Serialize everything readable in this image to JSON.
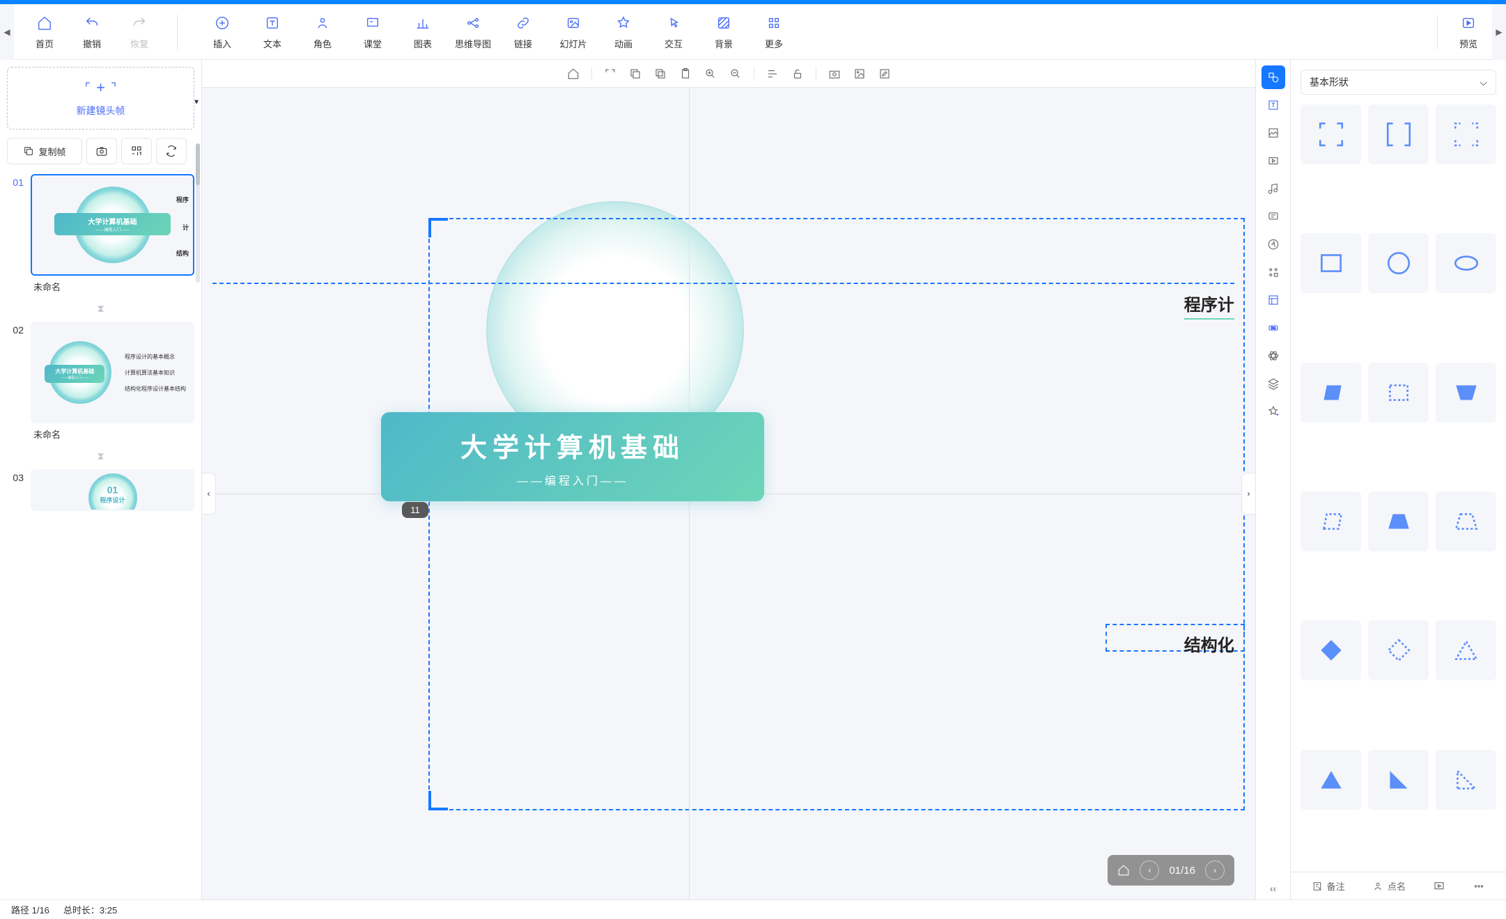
{
  "toolbar": {
    "left": [
      {
        "name": "home",
        "label": "首页",
        "icon": "home"
      },
      {
        "name": "undo",
        "label": "撤销",
        "icon": "undo"
      },
      {
        "name": "redo",
        "label": "恢复",
        "icon": "redo",
        "disabled": true
      }
    ],
    "main": [
      {
        "name": "insert",
        "label": "插入",
        "icon": "plus-circle"
      },
      {
        "name": "text",
        "label": "文本",
        "icon": "text"
      },
      {
        "name": "character",
        "label": "角色",
        "icon": "person"
      },
      {
        "name": "classroom",
        "label": "课堂",
        "icon": "class"
      },
      {
        "name": "chart",
        "label": "图表",
        "icon": "bar-chart"
      },
      {
        "name": "mindmap",
        "label": "思维导图",
        "icon": "mindmap"
      },
      {
        "name": "link",
        "label": "链接",
        "icon": "link"
      },
      {
        "name": "slideshow",
        "label": "幻灯片",
        "icon": "image"
      },
      {
        "name": "animation",
        "label": "动画",
        "icon": "star"
      },
      {
        "name": "interaction",
        "label": "交互",
        "icon": "pointer"
      },
      {
        "name": "background",
        "label": "背景",
        "icon": "stripes"
      },
      {
        "name": "more",
        "label": "更多",
        "icon": "grid"
      }
    ],
    "preview": {
      "label": "预览",
      "icon": "play"
    }
  },
  "leftPanel": {
    "newFrameLabel": "新建镜头帧",
    "copyFrameLabel": "复制帧",
    "slides": [
      {
        "num": "01",
        "title": "未命名",
        "bannerTitle": "大学计算机基础",
        "bannerSub": "——编程入门——",
        "labels": [
          "程序",
          "计",
          "结构"
        ],
        "active": true
      },
      {
        "num": "02",
        "title": "未命名",
        "bannerTitle": "大学计算机基础",
        "bannerSub": "——编程入门——",
        "lineList": [
          "程序设计的基本概念",
          "计算机算法基本知识",
          "结构化程序设计基本结构"
        ]
      },
      {
        "num": "03",
        "title": "",
        "bannerTitle": "01",
        "bannerSub": "程序设计"
      }
    ]
  },
  "canvas": {
    "bannerTitle": "大学计算机基础",
    "bannerSub": "——编程入门——",
    "badge": "11",
    "sideLabels": [
      "程序",
      "结构"
    ],
    "nav": {
      "current": "01",
      "total": "16",
      "display": "01/16"
    }
  },
  "rightPanel": {
    "selectLabel": "基本形狀",
    "footerBtns": [
      {
        "name": "notes",
        "label": "备注",
        "icon": "note"
      },
      {
        "name": "roll-call",
        "label": "点名",
        "icon": "person"
      },
      {
        "name": "present",
        "label": "",
        "icon": "present"
      },
      {
        "name": "more",
        "label": "",
        "icon": "more"
      }
    ]
  },
  "statusBar": {
    "path": "路径 1/16",
    "duration": "总时长：3:25"
  }
}
